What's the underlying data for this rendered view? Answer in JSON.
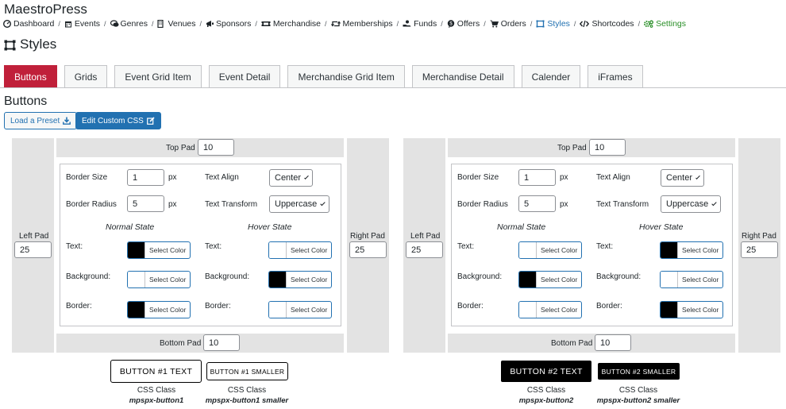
{
  "app": {
    "title": "MaestroPress"
  },
  "nav": {
    "separator": "/",
    "items": [
      {
        "label": "Dashboard",
        "icon": "dashboard-icon"
      },
      {
        "label": "Events",
        "icon": "calendar-icon"
      },
      {
        "label": "Genres",
        "icon": "comments-icon"
      },
      {
        "label": "Venues",
        "icon": "building-icon"
      },
      {
        "label": "Sponsors",
        "icon": "megaphone-icon"
      },
      {
        "label": "Merchandise",
        "icon": "ticket-icon"
      },
      {
        "label": "Memberships",
        "icon": "retweet-icon"
      },
      {
        "label": "Funds",
        "icon": "hand-money-icon"
      },
      {
        "label": "Offers",
        "icon": "badge-dollar-icon"
      },
      {
        "label": "Orders",
        "icon": "cart-icon"
      },
      {
        "label": "Styles",
        "icon": "crop-icon"
      },
      {
        "label": "Shortcodes",
        "icon": "code-icon"
      },
      {
        "label": "Settings",
        "icon": "gears-icon"
      }
    ]
  },
  "page": {
    "title": "Styles"
  },
  "tabs": [
    "Buttons",
    "Grids",
    "Event Grid Item",
    "Event Detail",
    "Merchandise Grid Item",
    "Merchandise Detail",
    "Calender",
    "iFrames"
  ],
  "section": {
    "title": "Buttons",
    "load_preset_label": "Load a Preset",
    "edit_css_label": "Edit Custom CSS"
  },
  "labels": {
    "top_pad": "Top Pad",
    "bottom_pad": "Bottom Pad",
    "left_pad": "Left Pad",
    "right_pad": "Right Pad",
    "border_size": "Border Size",
    "border_radius": "Border Radius",
    "text_align": "Text Align",
    "text_transform": "Text Transform",
    "px": "px",
    "normal_state": "Normal State",
    "hover_state": "Hover State",
    "text": "Text:",
    "background": "Background:",
    "border": "Border:",
    "select_color": "Select Color",
    "css_class": "CSS Class"
  },
  "colors": {
    "accent": "#2271b1",
    "active_tab": "#c0203a",
    "pad_bg": "#e3e3e3",
    "settings": "#2a8f28"
  },
  "buttons": [
    {
      "top_pad": "10",
      "bottom_pad": "10",
      "left_pad": "25",
      "right_pad": "25",
      "border_size": "1",
      "border_radius": "5",
      "text_align": "Center",
      "text_transform": "Uppercase",
      "normal": {
        "text": "#000000",
        "background": "#ffffff",
        "border": "#000000"
      },
      "hover": {
        "text": "#ffffff",
        "background": "#000000",
        "border": "#ffffff"
      },
      "preview_label": "BUTTON #1 TEXT",
      "preview_small_label": "BUTTON #1 SMALLER",
      "class_name": "mpspx-button1",
      "class_name_small": "mpspx-button1 smaller"
    },
    {
      "top_pad": "10",
      "bottom_pad": "10",
      "left_pad": "25",
      "right_pad": "25",
      "border_size": "1",
      "border_radius": "5",
      "text_align": "Center",
      "text_transform": "Uppercase",
      "normal": {
        "text": "#ffffff",
        "background": "#000000",
        "border": "#ffffff"
      },
      "hover": {
        "text": "#000000",
        "background": "#ffffff",
        "border": "#000000"
      },
      "preview_label": "BUTTON #2 TEXT",
      "preview_small_label": "BUTTON #2 SMALLER",
      "class_name": "mpspx-button2",
      "class_name_small": "mpspx-button2 smaller"
    }
  ]
}
